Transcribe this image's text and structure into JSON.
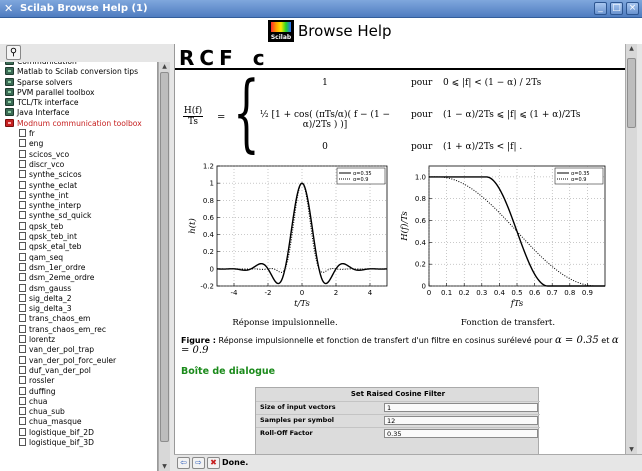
{
  "window": {
    "title": "Scilab Browse Help (1)",
    "buttons": {
      "minimize": "_",
      "maximize": "□",
      "close": "×"
    }
  },
  "header": {
    "logo_text": "Scilab",
    "title": "Browse Help"
  },
  "tree": {
    "books": [
      {
        "label": "Communication"
      },
      {
        "label": "Matlab to Scilab conversion tips"
      },
      {
        "label": "Sparse solvers"
      },
      {
        "label": "PVM parallel toolbox"
      },
      {
        "label": "TCL/Tk interface"
      },
      {
        "label": "Java Interface"
      },
      {
        "label": "Modnum communication toolbox",
        "open": true
      }
    ],
    "pages": [
      "fr",
      "eng",
      "scicos_vco",
      "discr_vco",
      "synthe_scicos",
      "synthe_eclat",
      "synthe_int",
      "synthe_interp",
      "synthe_sd_quick",
      "qpsk_teb",
      "qpsk_teb_int",
      "qpsk_etal_teb",
      "qam_seq",
      "dsm_1er_ordre",
      "dsm_2eme_ordre",
      "dsm_gauss",
      "sig_delta_2",
      "sig_delta_3",
      "trans_chaos_em",
      "trans_chaos_em_rec",
      "lorentz",
      "van_der_pol_trap",
      "van_der_pol_forc_euler",
      "duf_van_der_pol",
      "rossler",
      "duffing",
      "chua",
      "chua_sub",
      "chua_masque",
      "logistique_bif_2D",
      "logistique_bif_3D"
    ]
  },
  "content": {
    "page_title": "RCF_c",
    "formula": {
      "lhs_num": "H(f)",
      "lhs_den": "Ts",
      "equals": "=",
      "cases": [
        {
          "value": "1",
          "pour": "pour",
          "cond": "0 ⩽ |f| < (1 − α) / 2Ts"
        },
        {
          "value": "½ [1 + cos( (πTs/α)( f − (1 − α)/2Ts ) )]",
          "pour": "pour",
          "cond": "(1 − α)/2Ts ⩽ |f| ⩽ (1 + α)/2Ts"
        },
        {
          "value": "0",
          "pour": "pour",
          "cond": "(1 + α)/2Ts < |f| ."
        }
      ]
    },
    "figure_caption_label": "Figure :",
    "figure_caption_text": "Réponse impulsionnelle et fonction de transfert d'un filtre en cosinus surélevé pour",
    "figure_caption_alpha1": "α = 0.35",
    "figure_caption_and": "et",
    "figure_caption_alpha2": "α = 0.9",
    "section_title": "Boîte de dialogue",
    "dialog": {
      "title": "Set Raised Cosine Filter",
      "fields": [
        {
          "label": "Size of input vectors",
          "value": "1"
        },
        {
          "label": "Samples per symbol",
          "value": "12"
        },
        {
          "label": "Roll-Off Factor",
          "value": "0.35"
        }
      ]
    }
  },
  "chart_data": [
    {
      "type": "line",
      "title": "Réponse impulsionnelle.",
      "xlabel": "t/Ts",
      "ylabel": "h(t)",
      "xlim": [
        -5,
        5
      ],
      "ylim": [
        -0.2,
        1.2
      ],
      "xticks": [
        "-4",
        "-2",
        "0",
        "2",
        "4"
      ],
      "yticks": [
        "-0.2",
        "0",
        "0.2",
        "0.4",
        "0.6",
        "0.8",
        "1",
        "1.2"
      ],
      "grid": true,
      "legend": "top-right",
      "series": [
        {
          "name": "α=0.35",
          "style": "solid",
          "alpha": 0.35
        },
        {
          "name": "α=0.9",
          "style": "dotted",
          "alpha": 0.9
        }
      ]
    },
    {
      "type": "line",
      "title": "Fonction de transfert.",
      "xlabel": "fTs",
      "ylabel": "H(f)/Ts",
      "xlim": [
        0,
        1
      ],
      "ylim": [
        0,
        1.1
      ],
      "xticks": [
        "0",
        "0.1",
        "0.2",
        "0.3",
        "0.4",
        "0.5",
        "0.6",
        "0.7",
        "0.8",
        "0.9"
      ],
      "yticks": [
        "0",
        "0.2",
        "0.4",
        "0.6",
        "0.8",
        "1.0"
      ],
      "grid": true,
      "legend": "top-right",
      "series": [
        {
          "name": "α=0.35",
          "style": "solid",
          "alpha": 0.35
        },
        {
          "name": "α=0.9",
          "style": "dotted",
          "alpha": 0.9
        }
      ]
    }
  ],
  "statusbar": {
    "back": "⇦",
    "forward": "⇨",
    "stop": "✖",
    "text": "Done."
  }
}
